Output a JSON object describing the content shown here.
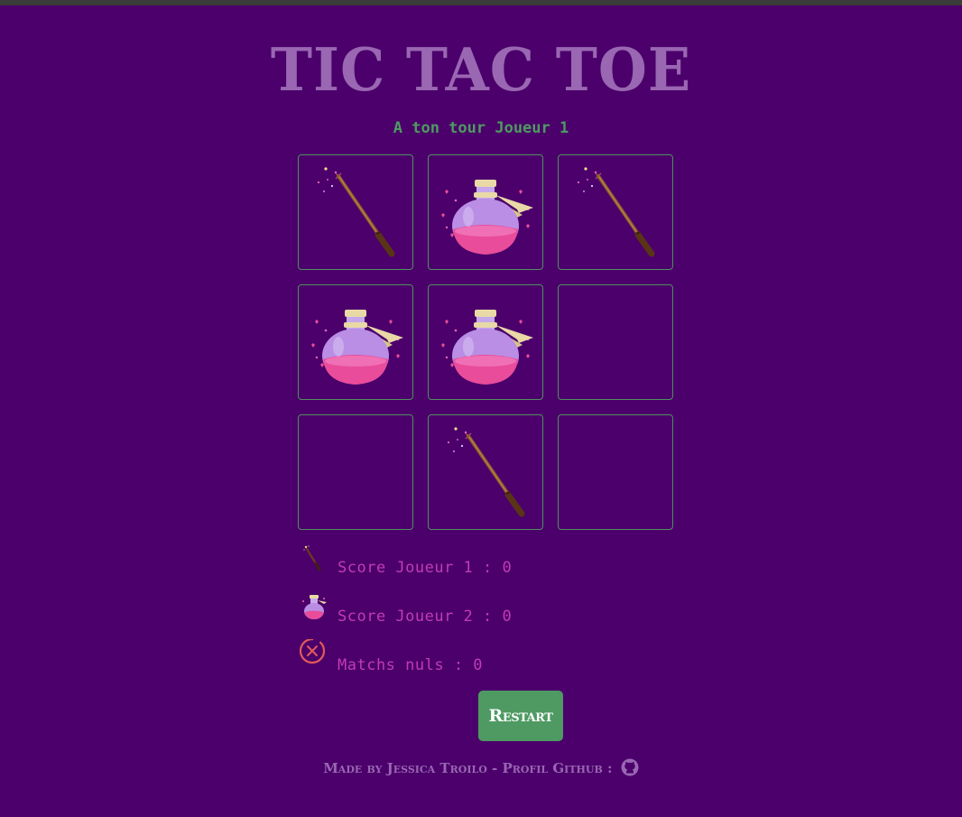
{
  "app": {
    "title": "TIC TAC TOE",
    "turn_text": "A ton tour Joueur 1"
  },
  "board": {
    "cells": [
      "wand",
      "potion",
      "wand",
      "potion",
      "potion",
      "",
      "",
      "wand",
      ""
    ]
  },
  "players": {
    "player1_symbol": "wand-icon",
    "player2_symbol": "potion-icon"
  },
  "scores": {
    "player1": "Score Joueur 1 : 0",
    "player2": "Score Joueur 2 : 0",
    "draws": "Matchs nuls : 0"
  },
  "buttons": {
    "restart": "Restart"
  },
  "footer": {
    "text": "Made by Jessica Troilo - Profil Github :",
    "link_icon": "github-icon"
  },
  "colors": {
    "background": "#4b006b",
    "accent_green": "#4e9a62",
    "title_purple": "#9a67b3",
    "score_pink": "#c23bb6",
    "draw_icon": "#e05a5a"
  }
}
